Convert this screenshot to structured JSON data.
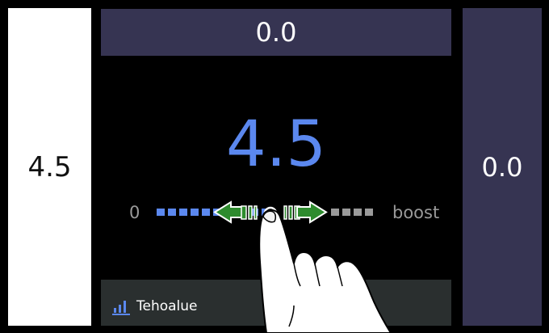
{
  "left_panel": {
    "value": "4.5"
  },
  "top_bar": {
    "value": "0.0"
  },
  "right_panel": {
    "value": "0.0"
  },
  "gauge": {
    "value": "4.5",
    "min_label": "0",
    "max_label": "boost",
    "active_color": "#5b88ef",
    "inactive_color": "#9a9a9a",
    "arrow_color": "#2e8b2e"
  },
  "bottom": {
    "left_label": "Tehoalue",
    "left_icon": "bar-chart-icon",
    "right_label": ""
  },
  "overlay": {
    "icon": "pointing-hand-icon"
  }
}
